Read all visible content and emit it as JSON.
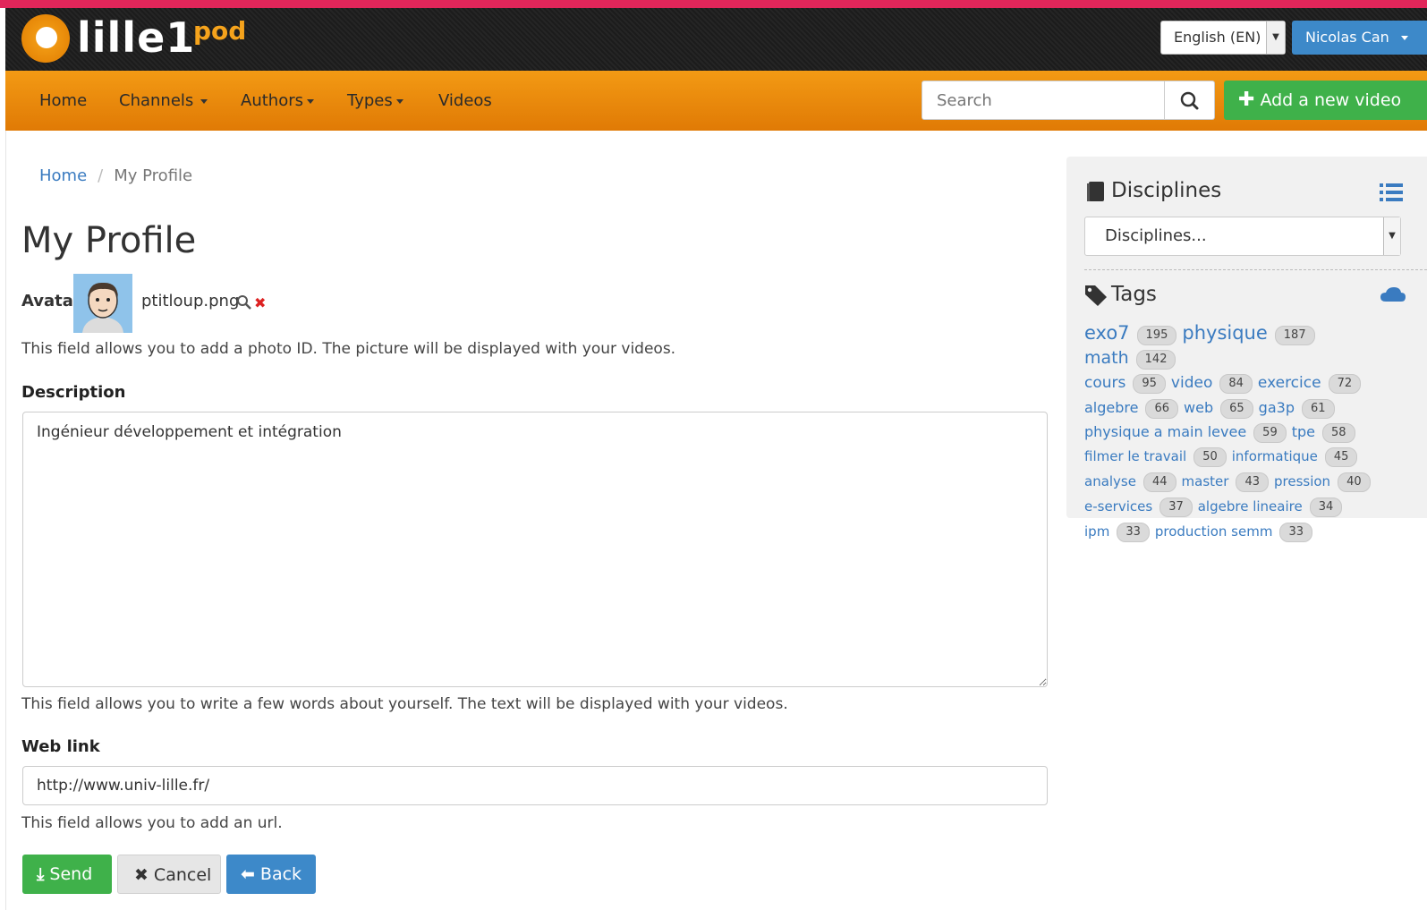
{
  "header": {
    "logo_text": "lille1",
    "logo_suffix": "pod",
    "language": "English (EN)",
    "user_name": "Nicolas Can"
  },
  "nav": {
    "items": [
      {
        "label": "Home",
        "dropdown": false
      },
      {
        "label": "Channels",
        "dropdown": true
      },
      {
        "label": "Authors",
        "dropdown": true
      },
      {
        "label": "Types",
        "dropdown": true
      },
      {
        "label": "Videos",
        "dropdown": false
      }
    ],
    "search_placeholder": "Search",
    "add_video_label": "Add a new video"
  },
  "breadcrumb": {
    "home": "Home",
    "current": "My Profile"
  },
  "page_title": "My Profile",
  "avatar": {
    "label": "Avatar",
    "filename": "ptitloup.png",
    "help": "This field allows you to add a photo ID. The picture will be displayed with your videos."
  },
  "description": {
    "label": "Description",
    "value": "Ingénieur développement et intégration",
    "help": "This field allows you to write a few words about yourself. The text will be displayed with your videos."
  },
  "weblink": {
    "label": "Web link",
    "value": "http://www.univ-lille.fr/",
    "help": "This field allows you to add an url."
  },
  "buttons": {
    "send": "Send",
    "cancel": "Cancel",
    "back": "Back"
  },
  "sidebar": {
    "disciplines_title": "Disciplines",
    "disciplines_selected": "Disciplines...",
    "tags_title": "Tags",
    "tags": [
      {
        "name": "exo7",
        "count": "195"
      },
      {
        "name": "physique",
        "count": "187"
      },
      {
        "name": "math",
        "count": "142"
      },
      {
        "name": "cours",
        "count": "95"
      },
      {
        "name": "video",
        "count": "84"
      },
      {
        "name": "exercice",
        "count": "72"
      },
      {
        "name": "algebre",
        "count": "66"
      },
      {
        "name": "web",
        "count": "65"
      },
      {
        "name": "ga3p",
        "count": "61"
      },
      {
        "name": "physique a main levee",
        "count": "59"
      },
      {
        "name": "tpe",
        "count": "58"
      },
      {
        "name": "filmer le travail",
        "count": "50"
      },
      {
        "name": "informatique",
        "count": "45"
      },
      {
        "name": "analyse",
        "count": "44"
      },
      {
        "name": "master",
        "count": "43"
      },
      {
        "name": "pression",
        "count": "40"
      },
      {
        "name": "e-services",
        "count": "37"
      },
      {
        "name": "algebre lineaire",
        "count": "34"
      },
      {
        "name": "ipm",
        "count": "33"
      },
      {
        "name": "production semm",
        "count": "33"
      }
    ]
  },
  "colors": {
    "top_accent": "#e1265a",
    "nav_orange": "#f39a14",
    "primary_blue": "#3d89c9",
    "success_green": "#3fb14a",
    "link_blue": "#3a7bc0"
  }
}
